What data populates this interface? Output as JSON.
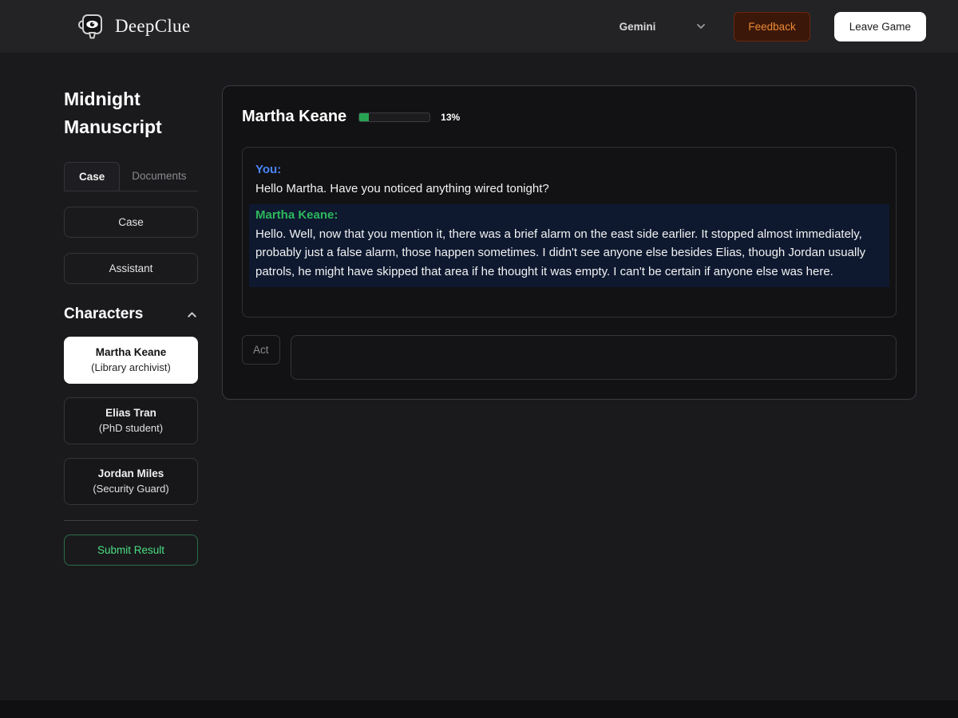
{
  "header": {
    "brand": "DeepClue",
    "model_selector": {
      "value": "Gemini"
    },
    "feedback_label": "Feedback",
    "leave_game_label": "Leave Game"
  },
  "sidebar": {
    "title": "Midnight Manuscript",
    "tabs": [
      {
        "label": "Case",
        "active": true
      },
      {
        "label": "Documents",
        "active": false
      }
    ],
    "nav_buttons": [
      {
        "label": "Case"
      },
      {
        "label": "Assistant"
      }
    ],
    "characters_heading": "Characters",
    "characters": [
      {
        "name": "Martha Keane",
        "role": "(Library archivist)",
        "active": true
      },
      {
        "name": "Elias Tran",
        "role": "(PhD student)",
        "active": false
      },
      {
        "name": "Jordan Miles",
        "role": "(Security Guard)",
        "active": false
      }
    ],
    "submit_label": "Submit Result"
  },
  "chat": {
    "character_name": "Martha Keane",
    "progress_percent": 13,
    "progress_label": "13%",
    "messages": [
      {
        "speaker": "You:",
        "type": "user",
        "text": "Hello Martha. Have you noticed anything wired tonight?"
      },
      {
        "speaker": "Martha Keane:",
        "type": "character",
        "text": "Hello. Well, now that you mention it, there was a brief alarm on the east side earlier. It stopped almost immediately, probably just a false alarm, those happen sometimes. I didn't see anyone else besides Elias, though Jordan usually patrols, he might have skipped that area if he thought it was empty. I can't be certain if anyone else was here."
      }
    ],
    "act_button_label": "Act",
    "input_value": ""
  },
  "colors": {
    "header_bg": "#232326",
    "page_bg": "#1a1a1d",
    "card_bg": "#121214",
    "you_label_blue": "#4a86f7",
    "character_label_green": "#2eb85c",
    "character_bubble_navy": "#0e1930",
    "progress_green": "#27a452",
    "feedback_orange": "#ed8936",
    "feedback_bg": "#3a1708",
    "submit_green": "#4ade80"
  }
}
